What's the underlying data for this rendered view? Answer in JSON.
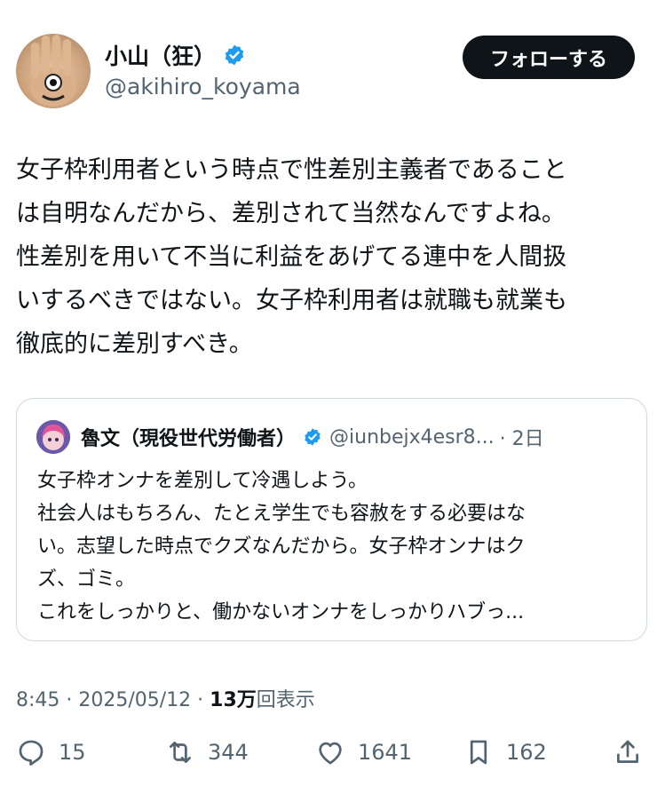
{
  "author": {
    "display_name": "小山（狂）",
    "handle": "@akihiro_koyama",
    "verified": true
  },
  "follow_button": "フォローする",
  "tweet": {
    "text": "女子枠利用者という時点で性差別主義者であること\nは自明なんだから、差別されて当然なんですよね。\n性差別を用いて不当に利益をあげてる連中を人間扱\nいするべきではない。女子枠利用者は就職も就業も\n徹底的に差別すべき。"
  },
  "quote": {
    "display_name": "魯文（現役世代労働者）",
    "handle": "@iunbejx4esr8...",
    "time": "· 2日",
    "text": "女子枠オンナを差別して冷遇しよう。\n社会人はもちろん、たとえ学生でも容赦をする必要はな\nい。志望した時点でクズなんだから。女子枠オンナはク\nズ、ゴミ。\nこれをしっかりと、働かないオンナをしっかりハブっ..."
  },
  "meta": {
    "time": "8:45 · 2025/05/12 · ",
    "views_count": "13万",
    "views_label": "回表示"
  },
  "actions": {
    "replies": "15",
    "reposts": "344",
    "likes": "1641",
    "bookmarks": "162"
  },
  "colors": {
    "text": "#0f1419",
    "secondary": "#536471",
    "verified": "#1d9bf0",
    "border": "#cfd9de"
  }
}
